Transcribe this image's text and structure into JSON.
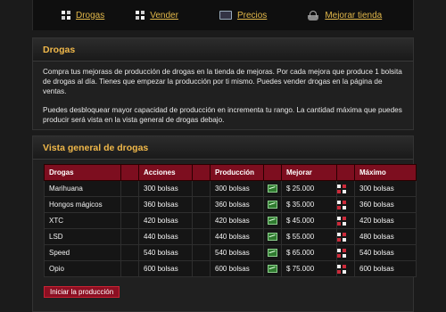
{
  "nav": [
    {
      "label": "Drogas",
      "icon": "grid-icon"
    },
    {
      "label": "Vender",
      "icon": "grid-icon"
    },
    {
      "label": "Precios",
      "icon": "screen-icon"
    },
    {
      "label": "Mejorar tienda",
      "icon": "basket-icon"
    }
  ],
  "intro": {
    "title": "Drogas",
    "paragraphs": [
      "Compra tus mejorass de producción de drogas en la tienda de mejoras. Por cada mejora que produce 1 bolsita de drogas al día. Tienes que empezar la producción por ti mismo. Puedes vender drogas en la página de ventas.",
      "Puedes desbloquear mayor capacidad de producción en incrementa tu rango. La cantidad máxima que puedes producir será vista en la vista general de drogas debajo."
    ]
  },
  "overview": {
    "title": "Vista general de drogas",
    "headers": [
      "Drogas",
      "Acciones",
      "Producción",
      "Mejorar",
      "Máximo"
    ],
    "rows": [
      {
        "name": "Marihuana",
        "acciones": "300 bolsas",
        "produccion": "300 bolsas",
        "mejorar": "$ 25.000",
        "maximo": "300 bolsas"
      },
      {
        "name": "Hongos mágicos",
        "acciones": "360 bolsas",
        "produccion": "360 bolsas",
        "mejorar": "$ 35.000",
        "maximo": "360 bolsas"
      },
      {
        "name": "XTC",
        "acciones": "420 bolsas",
        "produccion": "420 bolsas",
        "mejorar": "$ 45.000",
        "maximo": "420 bolsas"
      },
      {
        "name": "LSD",
        "acciones": "440 bolsas",
        "produccion": "440 bolsas",
        "mejorar": "$ 55.000",
        "maximo": "480 bolsas"
      },
      {
        "name": "Speed",
        "acciones": "540 bolsas",
        "produccion": "540 bolsas",
        "mejorar": "$ 65.000",
        "maximo": "540 bolsas"
      },
      {
        "name": "Opio",
        "acciones": "600 bolsas",
        "produccion": "600 bolsas",
        "mejorar": "$ 75.000",
        "maximo": "600 bolsas"
      }
    ],
    "start_button": "Iniciar la producción"
  },
  "colors": {
    "accent": "#e2b84a",
    "header_bg": "#7d0e1f",
    "button_bg": "#8c0f22"
  }
}
